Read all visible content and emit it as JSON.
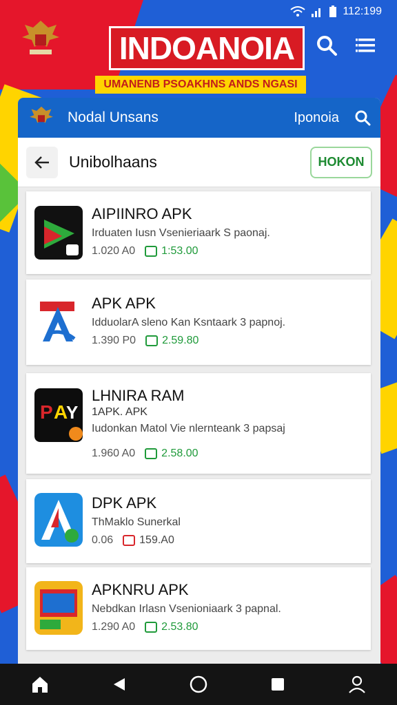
{
  "status_bar": {
    "time": "112:199"
  },
  "header": {
    "title": "INDOANOIA",
    "subtitle": "UMANENB PSOAKHNS ANDS NGASI"
  },
  "app_bar": {
    "name": "Nodal Unsans",
    "region": "Iponoia"
  },
  "sub_bar": {
    "title": "Unibolhaans",
    "action_label": "HOKON"
  },
  "items": [
    {
      "title": "AIPIINRO APK",
      "desc": "Irduaten Iusn Vsenieriaark S paonaj.",
      "size": "1.020 A0",
      "rating": "1:53.00",
      "icon": "app-icon-dark-green"
    },
    {
      "title": "APK APK",
      "desc": "IdduolarA sleno Kan Ksntaark 3 papnoj.",
      "size": "1.390 P0",
      "rating": "2.59.80",
      "icon": "app-icon-blue-a"
    },
    {
      "title": "LHNIRA RAM",
      "sub": "1APK. APK",
      "desc": "Iudonkan Matol Vie nlernteank 3 papsaj",
      "size": "1.960 A0",
      "rating": "2.58.00",
      "icon": "app-icon-pay"
    },
    {
      "title": "DPK APK",
      "desc": "ThMaklo Sunerkal",
      "size": "0.06",
      "rating": "159.A0",
      "icon": "app-icon-a-blue"
    },
    {
      "title": "APKNRU APK",
      "desc": "Nebdkan Irlasn Vsenioniaark 3 papnal.",
      "size": "1.290 A0",
      "rating": "2.53.80",
      "icon": "app-icon-colorful"
    }
  ],
  "colors": {
    "accent": "#1565c8",
    "brand_red": "#d81b23",
    "brand_yellow": "#ffd400",
    "positive": "#1f9a3a"
  }
}
